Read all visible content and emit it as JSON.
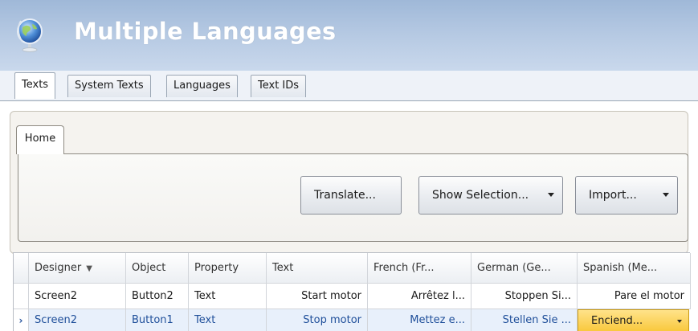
{
  "header": {
    "title": "Multiple Languages",
    "icon": "globe-icon"
  },
  "outer_tabs": [
    {
      "label": "Texts",
      "active": true
    },
    {
      "label": "System Texts",
      "active": false
    },
    {
      "label": "Languages",
      "active": false
    },
    {
      "label": "Text IDs",
      "active": false
    }
  ],
  "ribbon": {
    "tab_label": "Home",
    "buttons": {
      "translate": "Translate...",
      "show_selection": "Show Selection...",
      "import": "Import..."
    }
  },
  "grid": {
    "columns": [
      "",
      "Designer",
      "Object",
      "Property",
      "Text",
      "French (Fr...",
      "German (Ge...",
      "Spanish (Me..."
    ],
    "sorted_column_glyph": "▼",
    "rows": [
      {
        "marker": "",
        "designer": "Screen2",
        "object": "Button2",
        "property": "Text",
        "text": "Start motor",
        "french": "Arrêtez l...",
        "german": "Stoppen Si...",
        "spanish": "Pare el motor"
      },
      {
        "marker": "›",
        "designer": "Screen2",
        "object": "Button1",
        "property": "Text",
        "text": "Stop motor",
        "french": "Mettez e...",
        "german": "Stellen Sie ...",
        "spanish": "Enciend..."
      }
    ]
  },
  "colors": {
    "header_gradient_top": "#9fb8d8",
    "header_gradient_bottom": "#c9d8ec",
    "selected_row_text": "#1f4f9a",
    "edit_cell_fill": "#f9c93e"
  }
}
